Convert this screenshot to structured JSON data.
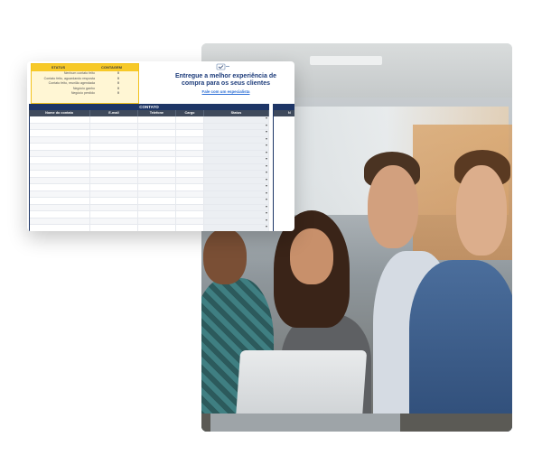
{
  "status_table": {
    "header": {
      "col1": "STATUS",
      "col2": "CONTAGEM"
    },
    "rows": [
      {
        "label": "Nenhum contato feito",
        "count": "0"
      },
      {
        "label": "Contato feito, aguardando resposta",
        "count": "0"
      },
      {
        "label": "Contato feito, reunião agendada",
        "count": "0"
      },
      {
        "label": "Negócio ganho",
        "count": "0"
      },
      {
        "label": "Negócio perdido",
        "count": "0"
      }
    ]
  },
  "promo": {
    "title": "Entregue a melhor experiência de compra para os seus clientes",
    "link": "Fale com um especialista"
  },
  "grid": {
    "section_title": "CONTATO",
    "columns": [
      "Nome do contato",
      "E-mail",
      "Telefone",
      "Cargo",
      "Status"
    ],
    "next_column_initial": "N"
  },
  "colors": {
    "navy": "#1d3566",
    "header_gray": "#3f4a5c",
    "status_yellow": "#f7c928",
    "link_blue": "#2d6fd6"
  }
}
